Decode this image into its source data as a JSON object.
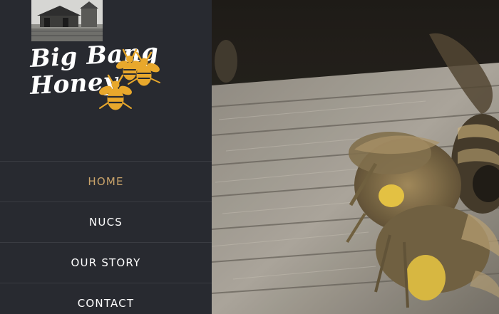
{
  "brand": {
    "logo_line1": "Big Bang",
    "logo_line2": "Honey",
    "accent_color": "#c9a36a",
    "bee_color": "#e8a82c",
    "header_image": "farm-photo",
    "logo_icon": "bee-icon"
  },
  "nav": {
    "items": [
      {
        "label": "HOME",
        "active": true
      },
      {
        "label": "NUCS",
        "active": false
      },
      {
        "label": "OUR STORY",
        "active": false
      },
      {
        "label": "CONTACT",
        "active": false
      }
    ]
  },
  "hero": {
    "subject": "bees-on-hive-entrance",
    "media": "background-video"
  }
}
